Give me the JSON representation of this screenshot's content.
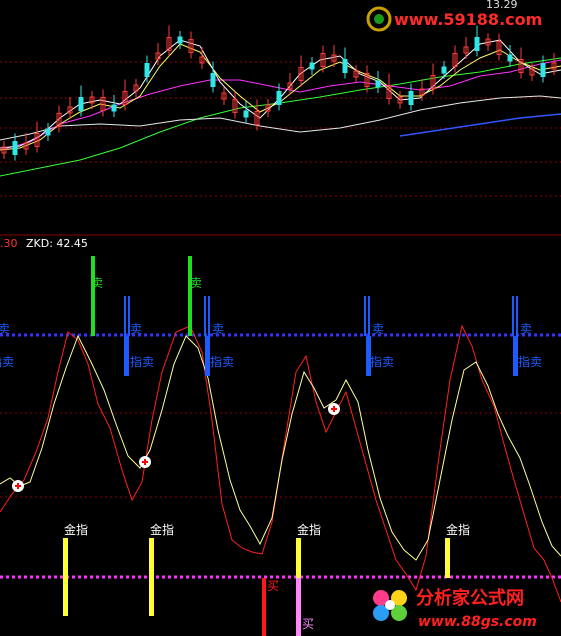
{
  "upper_panel": {
    "price_label": "13.29",
    "watermark": "www.59188.com"
  },
  "lower_panel": {
    "indicator_value_partial": ".30",
    "indicator_label": "ZKD: 42.45",
    "signals": {
      "sell_green": "卖",
      "sell_blue": "卖",
      "index_sell": "指卖",
      "golden_index": "金指",
      "buy": "买"
    }
  },
  "footer": {
    "logo_text": "分析家公式网",
    "logo_url": "www.88gs.com"
  },
  "colors": {
    "background": "#000000",
    "grid": "#8b0000",
    "up_candle": "#ff3a3a",
    "down_candle": "#30e6e6",
    "ma_white": "#ffffff",
    "ma_yellow": "#ffff66",
    "ma_magenta": "#ff33ff",
    "ma_green": "#33ff33",
    "ma_blue": "#3355ff",
    "line_red": "#ff2020",
    "line_yellow": "#ffff99",
    "signal_green": "#22dd22",
    "signal_blue": "#1e5bff",
    "golden_bar": "#ffff33",
    "dotted_blue": "#3333ff",
    "dotted_magenta": "#ff33ff"
  }
}
